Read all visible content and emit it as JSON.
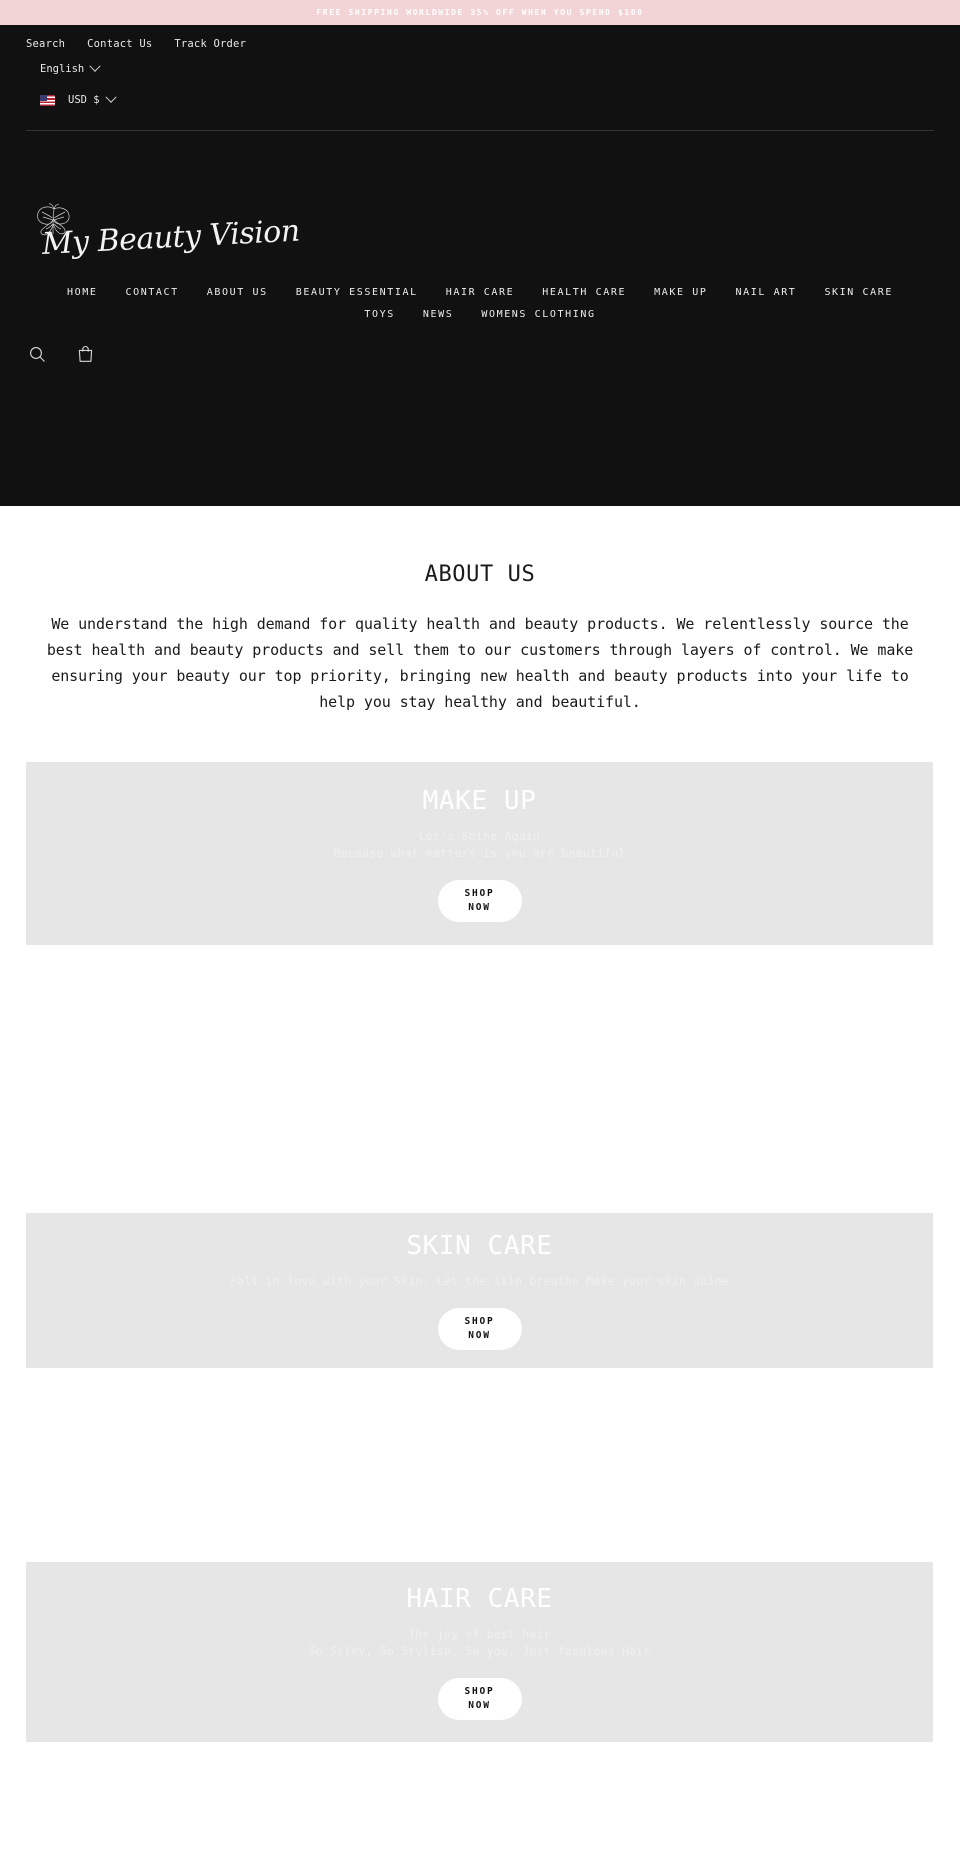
{
  "announcement": {
    "text": "FREE SHIPPING WORLDWIDE 35% OFF WHEN YOU SPEND $100",
    "background": "#f2d4d7",
    "text_color": "#ffffff"
  },
  "header": {
    "background": "#111111",
    "utility_links": [
      {
        "label": "Search",
        "name": "utility-link-search"
      },
      {
        "label": "Contact Us",
        "name": "utility-link-contact-us"
      },
      {
        "label": "Track Order",
        "name": "utility-link-track-order"
      }
    ],
    "language_selector": {
      "value": "English",
      "icon": "chevron-down-icon"
    },
    "currency_selector": {
      "value": "USD $",
      "flag": "us-flag-icon",
      "icon": "chevron-down-icon"
    },
    "logo": {
      "wordmark": "My Beauty Vision",
      "icon": "butterfly-icon"
    },
    "nav_items": [
      {
        "label": "HOME"
      },
      {
        "label": "CONTACT"
      },
      {
        "label": "ABOUT US"
      },
      {
        "label": "BEAUTY ESSENTIAL"
      },
      {
        "label": "HAIR CARE"
      },
      {
        "label": "HEALTH CARE"
      },
      {
        "label": "MAKE UP"
      },
      {
        "label": "NAIL ART"
      },
      {
        "label": "SKIN CARE"
      },
      {
        "label": "TOYS"
      },
      {
        "label": "NEWS"
      },
      {
        "label": "WOMENS CLOTHING"
      }
    ],
    "icons": [
      {
        "name": "search-icon",
        "label": "Search"
      },
      {
        "name": "shopping-bag-icon",
        "label": "Cart"
      }
    ]
  },
  "about": {
    "title": "ABOUT US",
    "body": "We understand the high demand for quality health and beauty products. We relentlessly source the best health and beauty products and sell them to our customers through layers of control. We make ensuring your beauty our top priority, bringing new health and beauty products into your life to help you stay healthy and beautiful."
  },
  "banners": {
    "background": "#e6e6e6",
    "makeup": {
      "title": "MAKE UP",
      "subtitle_line1": "Let's Shine Again",
      "subtitle_line2": "Because what matters is you are beautiful",
      "cta_line1": "SHOP",
      "cta_line2": "NOW"
    },
    "skincare": {
      "title": "SKIN CARE",
      "subtitle_line1": "Fall in love with your Skin. Let the skin breathe Make your skin shine",
      "subtitle_line2": "",
      "cta_line1": "SHOP",
      "cta_line2": "NOW"
    },
    "haircare": {
      "title": "HAIR CARE",
      "subtitle_line1": "The joy of best hair",
      "subtitle_line2": "So Silky, So Stylish, So you, Just fabulous Hair",
      "cta_line1": "SHOP",
      "cta_line2": "NOW"
    }
  }
}
